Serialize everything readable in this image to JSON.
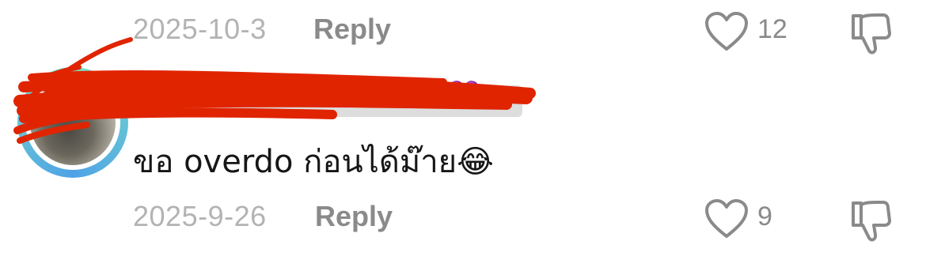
{
  "comments": [
    {
      "date": "2025-10-3",
      "reply_label": "Reply",
      "like_count": "12",
      "like_icon": "heart-outline-icon",
      "dislike_icon": "thumbs-down-outline-icon"
    },
    {
      "author": {
        "username_redacted": true,
        "avatar": "avatar-image",
        "badge": "💜"
      },
      "text": "ขอ overdo ก่อนได้ม๊าย😂",
      "date": "2025-9-26",
      "reply_label": "Reply",
      "like_count": "9",
      "like_icon": "heart-outline-icon",
      "dislike_icon": "thumbs-down-outline-icon"
    }
  ],
  "colors": {
    "meta_text": "#8a8a8a",
    "date_text": "#b3b3b3",
    "body_text": "#161616",
    "redaction": "#e02400",
    "avatar_ring": "#7ce2c5"
  }
}
